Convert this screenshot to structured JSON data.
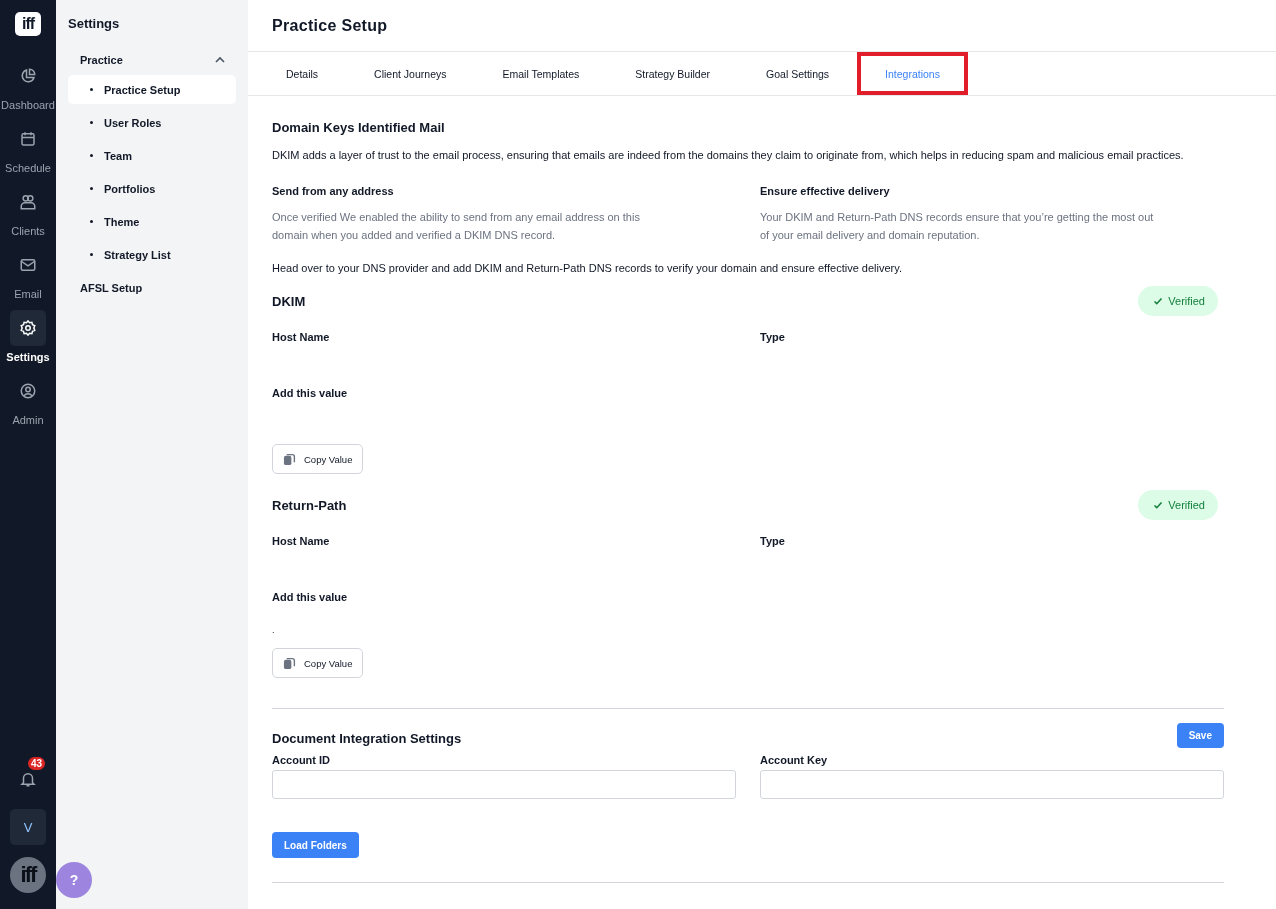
{
  "rail": {
    "logo": "iff",
    "items": [
      {
        "label": "Dashboard",
        "selected": false
      },
      {
        "label": "Schedule",
        "selected": false
      },
      {
        "label": "Clients",
        "selected": false
      },
      {
        "label": "Email",
        "selected": false
      },
      {
        "label": "Settings",
        "selected": true
      },
      {
        "label": "Admin",
        "selected": false
      }
    ],
    "notifications": {
      "count": "43"
    },
    "user": {
      "initial": "V"
    },
    "avatar_logo": "iff"
  },
  "help_button": "?",
  "sidebar": {
    "title": "Settings",
    "groups": [
      {
        "label": "Practice",
        "expanded": true,
        "children": [
          {
            "label": "Practice Setup",
            "selected": true
          },
          {
            "label": "User Roles",
            "selected": false
          },
          {
            "label": "Team",
            "selected": false
          },
          {
            "label": "Portfolios",
            "selected": false
          },
          {
            "label": "Theme",
            "selected": false
          },
          {
            "label": "Strategy List",
            "selected": false
          }
        ]
      },
      {
        "label": "AFSL Setup"
      }
    ]
  },
  "page_title": "Practice Setup",
  "tabs": [
    {
      "label": "Details",
      "selected": false,
      "annotated": false
    },
    {
      "label": "Client Journeys",
      "selected": false,
      "annotated": false
    },
    {
      "label": "Email Templates",
      "selected": false,
      "annotated": false
    },
    {
      "label": "Strategy Builder",
      "selected": false,
      "annotated": false
    },
    {
      "label": "Goal Settings",
      "selected": false,
      "annotated": false
    },
    {
      "label": "Integrations",
      "selected": true,
      "annotated": true
    }
  ],
  "dkim": {
    "title": "Domain Keys Identified Mail",
    "description": "DKIM adds a layer of trust to the email process, ensuring that emails are indeed from the domains they claim to originate from, which helps in reducing spam and malicious email practices.",
    "features": [
      {
        "title": "Send from any address",
        "text": "Once verified We enabled the ability to send from any email address on this domain when you added and verified a DKIM DNS record."
      },
      {
        "title": "Ensure effective delivery",
        "text": "Your DKIM and Return-Path DNS records ensure that you’re getting the most out of your email delivery and domain reputation."
      }
    ],
    "instruction": "Head over to your DNS provider and add DKIM and Return-Path DNS records to verify your domain and ensure effective delivery."
  },
  "records": [
    {
      "title": "DKIM",
      "status": "Verified",
      "verified": true,
      "host_label": "Host Name",
      "type_label": "Type",
      "value_label": "Add this value",
      "copy_button": "Copy Value"
    },
    {
      "title": "Return-Path",
      "status": "Verified",
      "verified": true,
      "host_label": "Host Name",
      "type_label": "Type",
      "value_label": "Add this value",
      "value": ".",
      "copy_button": "Copy Value"
    }
  ],
  "document_integration": {
    "title": "Document Integration Settings",
    "save_button": "Save",
    "fields": [
      {
        "label": "Account ID"
      },
      {
        "label": "Account Key"
      }
    ],
    "load_button": "Load Folders"
  }
}
